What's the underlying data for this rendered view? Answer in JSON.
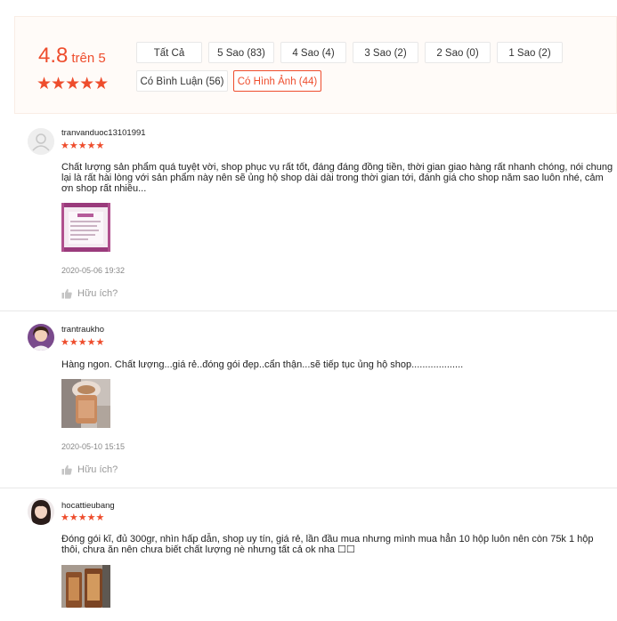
{
  "summary": {
    "score": "4.8",
    "score_suffix": "trên 5",
    "stars": "★★★★★",
    "filters": [
      "Tất Cả",
      "5 Sao (83)",
      "4 Sao (4)",
      "3 Sao (2)",
      "2 Sao (0)",
      "1 Sao (2)",
      "Có Bình Luận (56)",
      "Có Hình Ảnh (44)"
    ],
    "active_filter": "Có Hình Ảnh (44)"
  },
  "colors": {
    "accent": "#ee4d2d",
    "summary_bg": "#fffbf8"
  },
  "reviews": [
    {
      "username": "tranvanduoc13101991",
      "stars": "★★★★★",
      "comment": "Chất lượng sản phẩm quá tuyệt vời, shop phục vụ rất tốt, đáng đáng đồng tiền, thời gian giao hàng rất nhanh chóng, nói chung lại là rất hài lòng với sản phẩm này nên sẽ ủng hộ shop dài dài trong thời gian tới, đánh giá cho shop năm sao luôn nhé, cảm ơn shop rất nhiều...",
      "date": "2020-05-06 19:32",
      "helpful": "Hữu ích?"
    },
    {
      "username": "trantraukho",
      "stars": "★★★★★",
      "comment": "Hàng ngon. Chất lượng...giá rẻ..đóng gói đẹp..cẩn thận...sẽ tiếp tục ủng hộ shop...................",
      "date": "2020-05-10 15:15",
      "helpful": "Hữu ích?"
    },
    {
      "username": "hocattieubang",
      "stars": "★★★★★",
      "comment": "Đóng gói kĩ, đủ 300gr, nhìn hấp dẫn, shop uy tín, giá rẻ, lần đầu mua nhưng mình mua hẳn 10 hộp luôn nên còn 75k 1 hộp thôi, chưa ăn nên chưa biết chất lượng nè nhưng tất cả ok nha ☐☐"
    }
  ],
  "icons": {
    "thumb": "thumbs-up-icon",
    "more": "more-options-icon"
  }
}
